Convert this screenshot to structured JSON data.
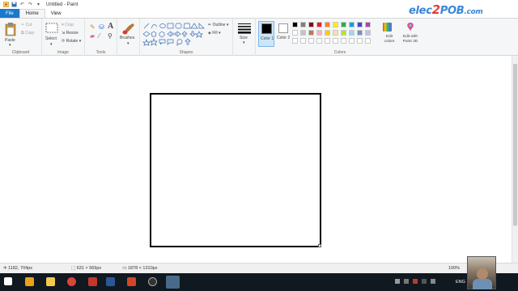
{
  "window": {
    "title": "Untitled - Paint"
  },
  "menu": {
    "file": "File",
    "home": "Home",
    "view": "View"
  },
  "clipboard": {
    "paste": "Paste",
    "cut": "Cut",
    "copy": "Copy",
    "group": "Clipboard"
  },
  "image": {
    "select": "Select",
    "crop": "Crop",
    "resize": "Resize",
    "rotate": "Rotate",
    "group": "Image"
  },
  "tools": {
    "group": "Tools",
    "text_tool": "A"
  },
  "brushes": {
    "label": "Brushes"
  },
  "shapes": {
    "outline": "Outline",
    "fill": "Fill",
    "group": "Shapes"
  },
  "size": {
    "label": "Size"
  },
  "colors": {
    "color1_label": "Color 1",
    "color2_label": "Color 2",
    "edit_colors": "Edit colors",
    "edit_paint3d": "Edit with Paint 3D",
    "group": "Colors",
    "color1": "#000000",
    "color2": "#ffffff",
    "palette_row1": [
      "#000000",
      "#7f7f7f",
      "#880015",
      "#ed1c24",
      "#ff7f27",
      "#fff200",
      "#22b14c",
      "#00a2e8",
      "#3f48cc",
      "#a349a4"
    ],
    "palette_row2": [
      "#ffffff",
      "#c3c3c3",
      "#b97a57",
      "#ffaec9",
      "#ffc90e",
      "#efe4b0",
      "#b5e61d",
      "#99d9ea",
      "#7092be",
      "#c8bfe7"
    ]
  },
  "status": {
    "cursor_pos": "1182, 704px",
    "selection_size": "631 × 569px",
    "image_size": "1878 × 1310px",
    "zoom": "100%"
  },
  "watermark": {
    "text_a": "elec",
    "text_num": "2",
    "text_b": "POB",
    "text_c": ".com"
  },
  "taskbar": {
    "language": "ENG"
  }
}
